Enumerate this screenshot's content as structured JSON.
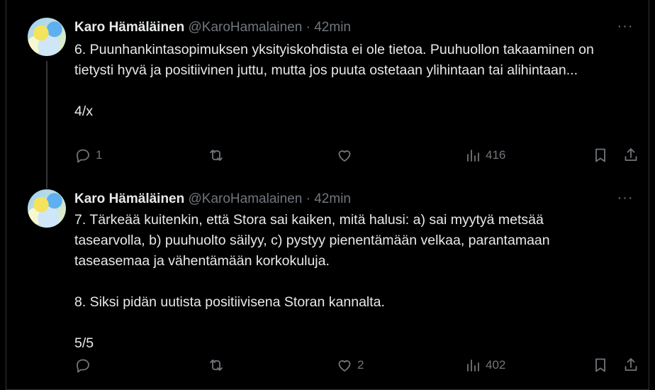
{
  "tweets": [
    {
      "author_name": "Karo Hämäläinen",
      "author_handle": "@KaroHamalainen",
      "separator": "·",
      "time": "42min",
      "more": "···",
      "text": "6. Puunhankintasopimuksen yksityiskohdista ei ole tietoa. Puuhuollon takaaminen on tietysti hyvä ja positiivinen juttu, mutta jos puuta ostetaan ylihintaan tai alihintaan...\n\n4/x",
      "replies": "1",
      "reposts": "",
      "likes": "",
      "views": "416"
    },
    {
      "author_name": "Karo Hämäläinen",
      "author_handle": "@KaroHamalainen",
      "separator": "·",
      "time": "42min",
      "more": "···",
      "text": "7. Tärkeää kuitenkin, että Stora sai kaiken, mitä halusi: a) sai myytyä metsää tasearvolla, b) puuhuolto säilyy, c) pystyy pienentämään velkaa, parantamaan taseasemaa ja vähentämään korkokuluja.\n\n8. Siksi pidän uutista positiivisena Storan kannalta.\n\n5/5",
      "replies": "",
      "reposts": "",
      "likes": "2",
      "views": "402"
    }
  ],
  "icons": {
    "reply": "reply-icon",
    "repost": "repost-icon",
    "like": "like-icon",
    "views": "views-icon",
    "bookmark": "bookmark-icon",
    "share": "share-icon",
    "more": "more-icon"
  },
  "colors": {
    "background": "#000000",
    "text": "#e7e9ea",
    "muted": "#71767b",
    "border": "#2f3336"
  }
}
